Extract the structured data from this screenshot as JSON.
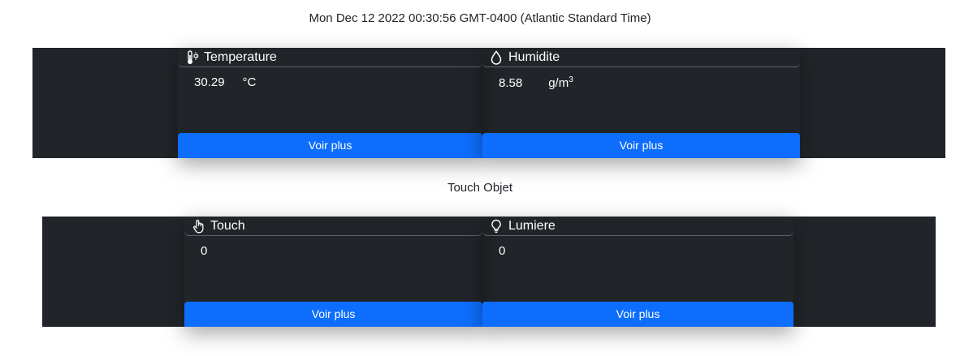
{
  "datetime": "Mon Dec 12 2022 00:30:56 GMT-0400 (Atlantic Standard Time)",
  "section_title": "Touch Objet",
  "cards": [
    {
      "title": "Temperature",
      "icon": "thermometer-sun-icon",
      "value": "30.29",
      "unit": "°C",
      "button": "Voir plus"
    },
    {
      "title": "Humidite",
      "icon": "droplet-icon",
      "value": "8.58",
      "unit_base": "g/m",
      "unit_exp": "3",
      "button": "Voir plus"
    },
    {
      "title": "Touch",
      "icon": "hand-pointer-icon",
      "value": "0",
      "button": "Voir plus"
    },
    {
      "title": "Lumiere",
      "icon": "lightbulb-icon",
      "value": "0",
      "button": "Voir plus"
    }
  ],
  "colors": {
    "panel": "#212529",
    "button": "#0d6efd",
    "text_light": "#ffffff",
    "page": "#ffffff"
  }
}
